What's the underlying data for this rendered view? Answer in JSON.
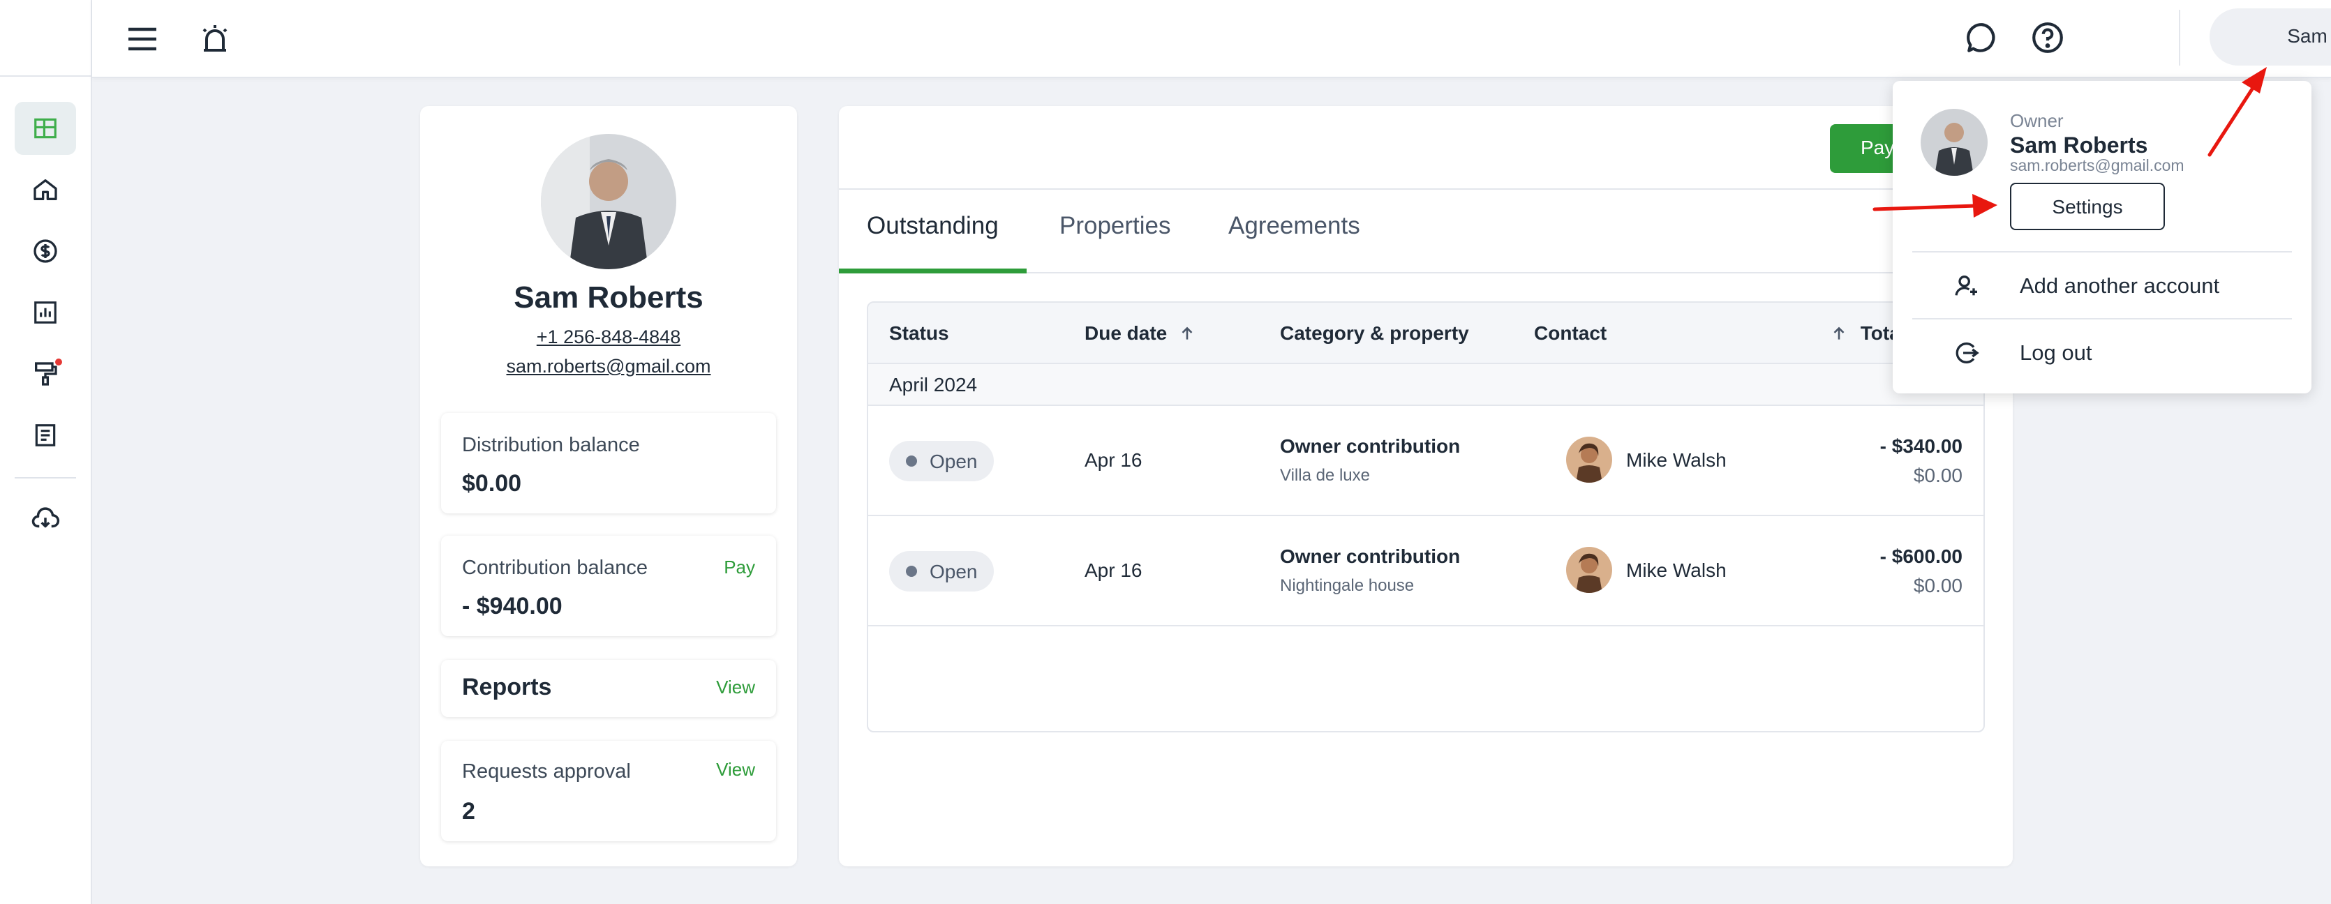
{
  "topbar": {
    "menu_icon": "hamburger-menu-icon",
    "alert_icon": "alarm-bell-icon",
    "chat_icon": "chat-bubble-icon",
    "help_icon": "help-circle-icon",
    "user_name": "Sam"
  },
  "sidebar": {
    "items": [
      {
        "name": "dashboard",
        "icon": "dashboard-grid-icon",
        "active": true
      },
      {
        "name": "home",
        "icon": "home-icon"
      },
      {
        "name": "payments",
        "icon": "dollar-circle-icon"
      },
      {
        "name": "reports",
        "icon": "bar-chart-icon"
      },
      {
        "name": "maintenance",
        "icon": "paint-roller-icon",
        "badge": true
      },
      {
        "name": "documents",
        "icon": "document-icon"
      },
      {
        "name": "downloads",
        "icon": "cloud-download-icon"
      }
    ]
  },
  "profile": {
    "name": "Sam Roberts",
    "phone": "+1 256-848-4848",
    "email": "sam.roberts@gmail.com",
    "distribution": {
      "label": "Distribution balance",
      "value": "$0.00"
    },
    "contribution": {
      "label": "Contribution balance",
      "value": "- $940.00",
      "action": "Pay"
    },
    "reports": {
      "title": "Reports",
      "action": "View"
    },
    "requests": {
      "label": "Requests approval",
      "value": "2",
      "action": "View"
    }
  },
  "main": {
    "pay_button": "Pay",
    "tabs": [
      {
        "label": "Outstanding",
        "active": true
      },
      {
        "label": "Properties"
      },
      {
        "label": "Agreements"
      }
    ],
    "table": {
      "headers": {
        "status": "Status",
        "due_date": "Due date",
        "category": "Category & property",
        "contact": "Contact",
        "total": "Tota"
      },
      "group": "April 2024",
      "rows": [
        {
          "status": "Open",
          "due": "Apr 16",
          "category": "Owner contribution",
          "property": "Villa de luxe",
          "contact": "Mike Walsh",
          "amount": "- $340.00",
          "paid": "$0.00"
        },
        {
          "status": "Open",
          "due": "Apr 16",
          "category": "Owner contribution",
          "property": "Nightingale house",
          "contact": "Mike Walsh",
          "amount": "- $600.00",
          "paid": "$0.00"
        }
      ]
    }
  },
  "dropdown": {
    "role": "Owner",
    "name": "Sam Roberts",
    "email": "sam.roberts@gmail.com",
    "settings": "Settings",
    "add_account": "Add another account",
    "logout": "Log out"
  },
  "colors": {
    "accent": "#2e9c3a",
    "annotation": "#e8170f",
    "text": "#1f2a37"
  }
}
